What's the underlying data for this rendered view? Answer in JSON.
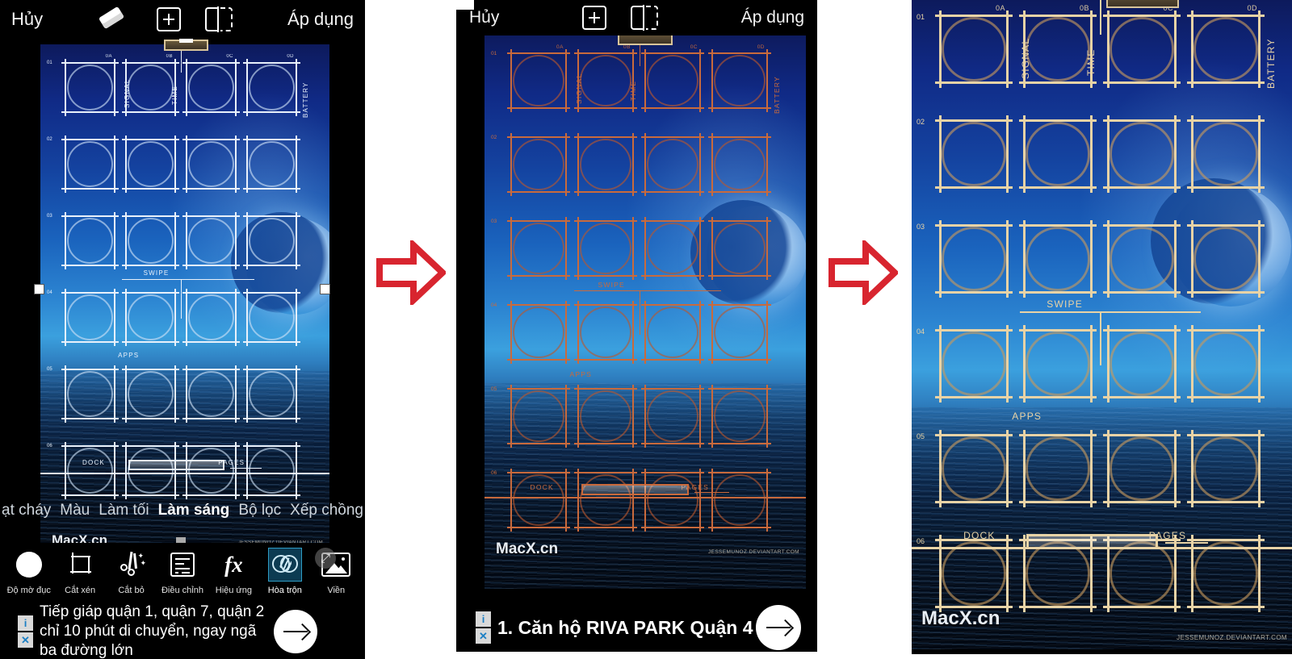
{
  "panels": [
    {
      "id": "panel-editor-full",
      "topbar": {
        "cancel": "Hủy",
        "apply": "Áp dụng",
        "icons": [
          "eraser-icon",
          "add-layer-icon",
          "split-view-icon"
        ]
      },
      "blend_modes": {
        "items": [
          "ạt cháy",
          "Màu",
          "Làm tối",
          "Làm sáng",
          "Bộ lọc",
          "Xếp chồng"
        ],
        "active": "Làm sáng"
      },
      "tools": [
        {
          "label": "Độ mờ đục",
          "icon": "opacity-icon",
          "selected": false
        },
        {
          "label": "Cắt xén",
          "icon": "crop-icon",
          "selected": false
        },
        {
          "label": "Cắt bỏ",
          "icon": "cutout-icon",
          "selected": false
        },
        {
          "label": "Điều chỉnh",
          "icon": "adjust-icon",
          "selected": false
        },
        {
          "label": "Hiệu ứng",
          "icon": "effects-icon",
          "selected": false
        },
        {
          "label": "Hòa trộn",
          "icon": "blend-icon",
          "selected": true
        },
        {
          "label": "Viền",
          "icon": "border-icon",
          "selected": false
        }
      ],
      "ad": {
        "info_badge": "i",
        "close_badge": "✕",
        "text": "Tiếp giáp quận 1, quận 7, quận 2 chỉ 10 phút di chuyển, ngay ngã ba đường lớn",
        "cta": "arrow-right-icon"
      }
    },
    {
      "id": "panel-editor-preview",
      "topbar": {
        "cancel": "Hủy",
        "apply": "Áp dụng",
        "icons": [
          "add-layer-icon",
          "split-view-icon"
        ]
      },
      "ad": {
        "info_badge": "i",
        "close_badge": "✕",
        "text": "1. Căn hộ RIVA PARK Quận 4",
        "cta": "arrow-right-icon"
      }
    },
    {
      "id": "panel-result-zoomed"
    }
  ],
  "wallpaper": {
    "watermark_site": "MacX.cn",
    "watermark_author": "JESSEMUNOZ.DEVIANTART.COM",
    "column_ids": [
      "0A",
      "0B",
      "0C",
      "0D"
    ],
    "row_ids": [
      "01",
      "02",
      "03",
      "04",
      "05",
      "06"
    ],
    "annotations": {
      "signal": "SIGNAL",
      "time": "TIME",
      "battery": "BATTERY",
      "swipe": "SWIPE",
      "apps": "APPS",
      "dock": "DOCK",
      "pages": "PAGES"
    }
  },
  "transition": {
    "arrows": [
      "arrow-right-step-1",
      "arrow-right-step-2"
    ],
    "color": "#d8252f"
  },
  "colors": {
    "accent_selected": "#2f9cc4",
    "selected_tool_bg": "#0c3b52",
    "arrow_red": "#d8252f",
    "topbar_bg": "#000000",
    "wallpaper_line_white": "#e9f1fb",
    "wallpaper_line_orange": "#d7a35a",
    "wallpaper_line_tan": "#e8d3a6"
  }
}
